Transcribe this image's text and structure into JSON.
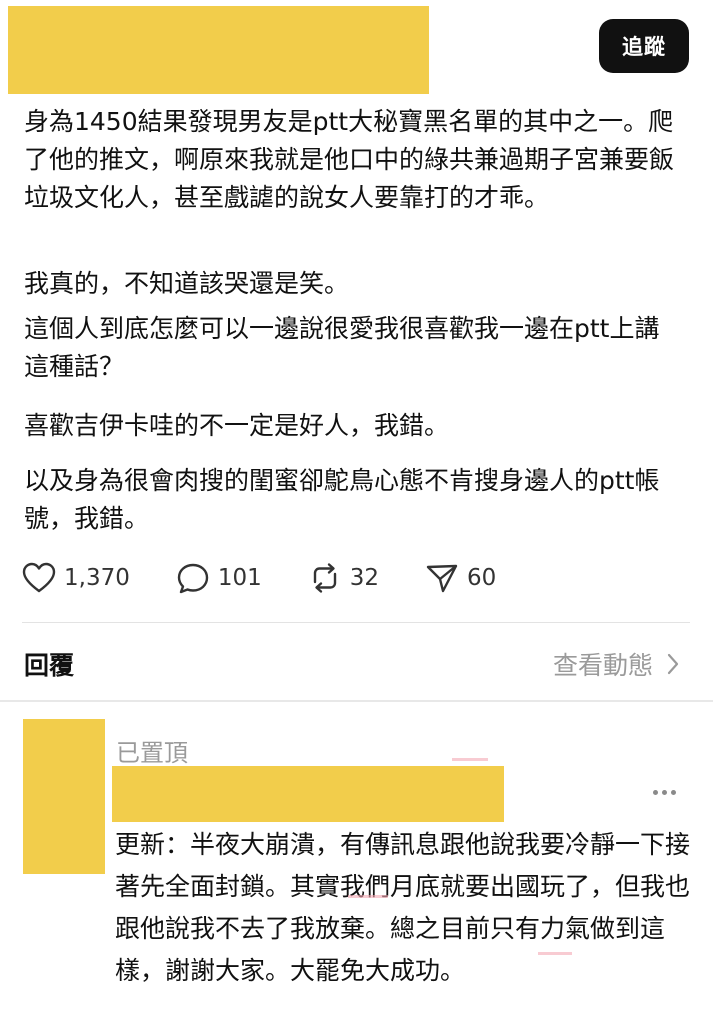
{
  "header": {
    "follow_label": "追蹤"
  },
  "post": {
    "paragraphs": [
      "身為1450結果發現男友是ptt大秘寶黑名單的其中之一。爬了他的推文，啊原來我就是他口中的綠共兼過期子宮兼要飯垃圾文化人，甚至戲謔的說女人要靠打的才乖。",
      "我真的，不知道該哭還是笑。",
      "這個人到底怎麼可以一邊說很愛我很喜歡我一邊在ptt上講這種話？",
      "喜歡吉伊卡哇的不一定是好人，我錯。",
      "以及身為很會肉搜的閨蜜卻鴕鳥心態不肯搜身邊人的ptt帳號，我錯。"
    ]
  },
  "actions": {
    "likes": "1,370",
    "comments": "101",
    "reposts": "32",
    "shares": "60"
  },
  "replies_bar": {
    "title": "回覆",
    "view_activity": "查看動態"
  },
  "reply": {
    "pinned_label": "已置頂",
    "text": "更新：半夜大崩潰，有傳訊息跟他說我要冷靜一下接著先全面封鎖。其實我們月底就要出國玩了，但我也跟他說我不去了我放棄。總之目前只有力氣做到這樣，謝謝大家。大罷免大成功。"
  },
  "colors": {
    "redaction": "#f2cd4b",
    "follow_bg": "#111111",
    "muted_text": "#9a9a9a"
  }
}
